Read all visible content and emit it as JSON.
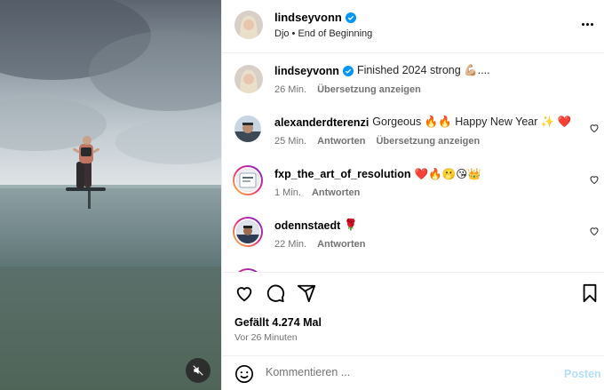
{
  "header": {
    "username": "lindseyvonn",
    "subtitle": "Djo • End of Beginning"
  },
  "caption": {
    "username": "lindseyvonn",
    "text": "Finished 2024 strong 💪🏼....",
    "time": "26 Min.",
    "translate": "Übersetzung anzeigen"
  },
  "comments": [
    {
      "username": "alexanderdterenzi",
      "text": "Gorgeous 🔥🔥 Happy New Year ✨ ❤️",
      "time": "25 Min.",
      "reply": "Antworten",
      "translate": "Übersetzung anzeigen"
    },
    {
      "username": "fxp_the_art_of_resolution",
      "text": "❤️🔥🫢😘👑",
      "time": "1 Min.",
      "reply": "Antworten"
    },
    {
      "username": "odennstaedt",
      "text": "🌹",
      "time": "22 Min.",
      "reply": "Antworten"
    }
  ],
  "post": {
    "likes": "Gefällt 4.274 Mal",
    "time": "Vor 26 Minuten"
  },
  "composer": {
    "placeholder": "Kommentieren ...",
    "post_label": "Posten"
  },
  "colors": {
    "verified": "#0095f6",
    "post_disabled": "#b2dffc",
    "meta": "#737373"
  }
}
